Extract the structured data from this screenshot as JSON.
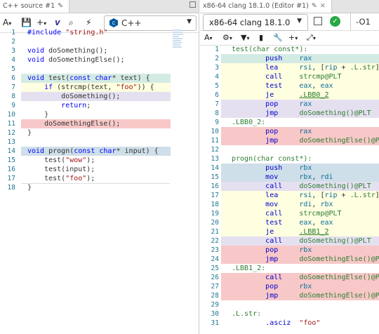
{
  "left": {
    "tab_title": "C++ source #1",
    "language": "C++",
    "lines": [
      {
        "n": "1",
        "hl": "",
        "html": "<span class='pp'>#include</span> <span class='str'>\"string.h\"</span>"
      },
      {
        "n": "2",
        "hl": "",
        "html": ""
      },
      {
        "n": "3",
        "hl": "",
        "html": "<span class='kw'>void</span> doSomething();"
      },
      {
        "n": "4",
        "hl": "",
        "html": "<span class='kw'>void</span> doSomethingElse();"
      },
      {
        "n": "5",
        "hl": "",
        "html": ""
      },
      {
        "n": "6",
        "hl": "teal",
        "html": "<span class='kw'>void</span> test(<span class='kw'>const</span> <span class='kw'>char</span>* text) {"
      },
      {
        "n": "7",
        "hl": "yel",
        "html": "    <span class='kw'>if</span> (strcmp(text, <span class='str'>\"foo\"</span>)) {"
      },
      {
        "n": "8",
        "hl": "lav",
        "html": "        doSomething();"
      },
      {
        "n": "9",
        "hl": "",
        "html": "        <span class='kw'>return</span>;"
      },
      {
        "n": "10",
        "hl": "",
        "html": "    }"
      },
      {
        "n": "11",
        "hl": "red",
        "html": "    doSomethingElse();"
      },
      {
        "n": "12",
        "hl": "",
        "html": "}"
      },
      {
        "n": "13",
        "hl": "",
        "html": ""
      },
      {
        "n": "14",
        "hl": "blue",
        "html": "<span class='kw'>void</span> progn(<span class='kw'>const</span> <span class='kw'>char</span>* input) {"
      },
      {
        "n": "15",
        "hl": "",
        "html": "    test(<span class='str'>\"wow\"</span>);"
      },
      {
        "n": "16",
        "hl": "",
        "html": "    test(input);"
      },
      {
        "n": "17",
        "hl": "",
        "html": "    test(<span class='str'>\"foo\"</span>);"
      },
      {
        "n": "18",
        "hl": "",
        "html": "}"
      }
    ]
  },
  "right": {
    "tab_title": "x86-64 clang 18.1.0 (Editor #1)",
    "compiler": "x86-64 clang 18.1.0",
    "flags": "-O1",
    "lines": [
      {
        "n": "1",
        "hl": "",
        "html": "<span class='lbl'>test(char const*):</span>"
      },
      {
        "n": "2",
        "hl": "teal",
        "html": "        <span class='op'>push</span>    <span class='reg'>rax</span>"
      },
      {
        "n": "3",
        "hl": "yel",
        "html": "        <span class='op'>lea</span>     <span class='reg'>rsi</span>, [<span class='reg'>rip</span> + <span class='lbl'>.L.str</span>]"
      },
      {
        "n": "4",
        "hl": "yel",
        "html": "        <span class='op'>call</span>    <span class='lbl'>strcmp@PLT</span>"
      },
      {
        "n": "5",
        "hl": "yel",
        "html": "        <span class='op'>test</span>    <span class='reg'>eax</span>, <span class='reg'>eax</span>"
      },
      {
        "n": "6",
        "hl": "yel",
        "html": "        <span class='op'>je</span>      <span class='ul'>.LBB0_2</span>"
      },
      {
        "n": "7",
        "hl": "lav",
        "html": "        <span class='op'>pop</span>     <span class='reg'>rax</span>"
      },
      {
        "n": "8",
        "hl": "lav",
        "html": "        <span class='op'>jmp</span>     <span class='lbl'>doSomething()@PLT</span>"
      },
      {
        "n": "9",
        "hl": "",
        "html": "<span class='lbl'>.LBB0_2:</span>"
      },
      {
        "n": "10",
        "hl": "red",
        "html": "        <span class='op'>pop</span>     <span class='reg'>rax</span>"
      },
      {
        "n": "11",
        "hl": "red",
        "html": "        <span class='op'>jmp</span>     <span class='lbl'>doSomethingElse()@PLT</span>"
      },
      {
        "n": "12",
        "hl": "",
        "html": ""
      },
      {
        "n": "13",
        "hl": "",
        "html": "<span class='lbl'>progn(char const*):</span>"
      },
      {
        "n": "14",
        "hl": "blue",
        "html": "        <span class='op'>push</span>    <span class='reg'>rbx</span>"
      },
      {
        "n": "15",
        "hl": "blue",
        "html": "        <span class='op'>mov</span>     <span class='reg'>rbx</span>, <span class='reg'>rdi</span>"
      },
      {
        "n": "16",
        "hl": "lav",
        "html": "        <span class='op'>call</span>    <span class='lbl'>doSomething()@PLT</span>"
      },
      {
        "n": "17",
        "hl": "yel",
        "html": "        <span class='op'>lea</span>     <span class='reg'>rsi</span>, [<span class='reg'>rip</span> + <span class='lbl'>.L.str</span>]"
      },
      {
        "n": "18",
        "hl": "yel",
        "html": "        <span class='op'>mov</span>     <span class='reg'>rdi</span>, <span class='reg'>rbx</span>"
      },
      {
        "n": "19",
        "hl": "yel",
        "html": "        <span class='op'>call</span>    <span class='lbl'>strcmp@PLT</span>"
      },
      {
        "n": "20",
        "hl": "yel",
        "html": "        <span class='op'>test</span>    <span class='reg'>eax</span>, <span class='reg'>eax</span>"
      },
      {
        "n": "21",
        "hl": "yel",
        "html": "        <span class='op'>je</span>      <span class='ul'>.LBB1_2</span>"
      },
      {
        "n": "22",
        "hl": "lav",
        "html": "        <span class='op'>call</span>    <span class='lbl'>doSomething()@PLT</span>"
      },
      {
        "n": "23",
        "hl": "red",
        "html": "        <span class='op'>pop</span>     <span class='reg'>rbx</span>"
      },
      {
        "n": "24",
        "hl": "red",
        "html": "        <span class='op'>jmp</span>     <span class='lbl'>doSomethingElse()@PLT</span>"
      },
      {
        "n": "25",
        "hl": "",
        "html": "<span class='lbl'>.LBB1_2:</span>"
      },
      {
        "n": "26",
        "hl": "red",
        "html": "        <span class='op'>call</span>    <span class='lbl'>doSomethingElse()@PLT</span>"
      },
      {
        "n": "27",
        "hl": "red",
        "html": "        <span class='op'>pop</span>     <span class='reg'>rbx</span>"
      },
      {
        "n": "28",
        "hl": "red",
        "html": "        <span class='op'>jmp</span>     <span class='lbl'>doSomethingElse()@PLT</span>"
      },
      {
        "n": "29",
        "hl": "",
        "html": ""
      },
      {
        "n": "30",
        "hl": "",
        "html": "<span class='lbl'>.L.str:</span>"
      },
      {
        "n": "31",
        "hl": "",
        "html": "        <span class='op'>.asciz</span>  <span class='str'>\"foo\"</span>"
      }
    ]
  }
}
